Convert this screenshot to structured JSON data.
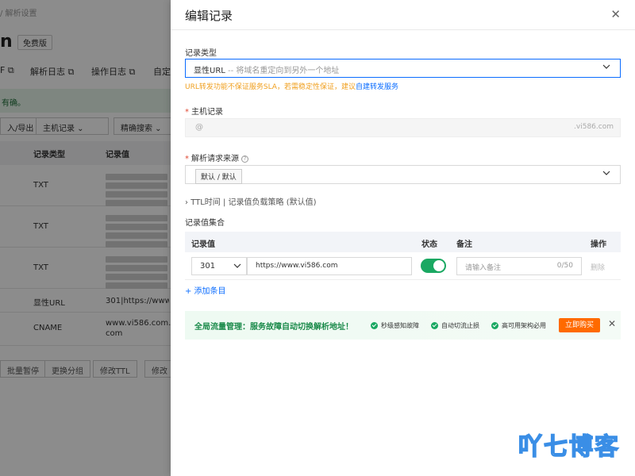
{
  "background": {
    "breadcrumb": "/ 解析设置",
    "title_fragment": "n",
    "badge": "免费版",
    "nav": [
      "F ⧉",
      "解析日志 ⧉",
      "操作日志 ⧉",
      "自定"
    ],
    "notice": "有确。",
    "buttons": [
      "入/导出",
      "主机记录",
      "精确搜索"
    ],
    "table_headers": [
      "记录类型",
      "记录值"
    ],
    "rows": [
      {
        "type": "TXT",
        "value": ""
      },
      {
        "type": "TXT",
        "value": ""
      },
      {
        "type": "TXT",
        "value": ""
      },
      {
        "type": "显性URL",
        "value": "301|https://www.vi5"
      },
      {
        "type": "CNAME",
        "value": "www.vi586.com.w.kun com"
      }
    ],
    "footer_buttons": [
      "批量暂停",
      "更换分组",
      "修改TTL",
      "修改"
    ]
  },
  "drawer": {
    "title": "编辑记录",
    "record_type": {
      "label": "记录类型",
      "value": "显性URL",
      "hint": "-- 将域名重定向到另外一个地址"
    },
    "warning": {
      "text": "URL转发功能不保证服务SLA，若需稳定性保证，建议",
      "link": "自建转发服务"
    },
    "host": {
      "label": "主机记录",
      "prefix": "@",
      "suffix": ".vi586.com"
    },
    "source": {
      "label": "解析请求来源",
      "value": "默认 / 默认"
    },
    "ttl_line": "TTL时间 | 记录值负载策略 (默认值)",
    "values_label": "记录值集合",
    "table": {
      "headers": [
        "记录值",
        "状态",
        "备注",
        "操作"
      ],
      "row": {
        "code": "301",
        "url": "https://www.vi586.com",
        "remark_placeholder": "请输入备注",
        "count": "0/50",
        "delete": "删除"
      }
    },
    "add_item": "+ 添加条目",
    "banner": {
      "title": "全局流量管理：服务故障自动切换解析地址！",
      "features": [
        "秒级感知故障",
        "自动切流止损",
        "高可用架构必用"
      ],
      "buy": "立即购买"
    }
  },
  "watermark": "吖七博客",
  "colors": {
    "primary": "#0a6cff",
    "success": "#1aa862",
    "warning": "#f0a020",
    "buy": "#ff6a00"
  }
}
